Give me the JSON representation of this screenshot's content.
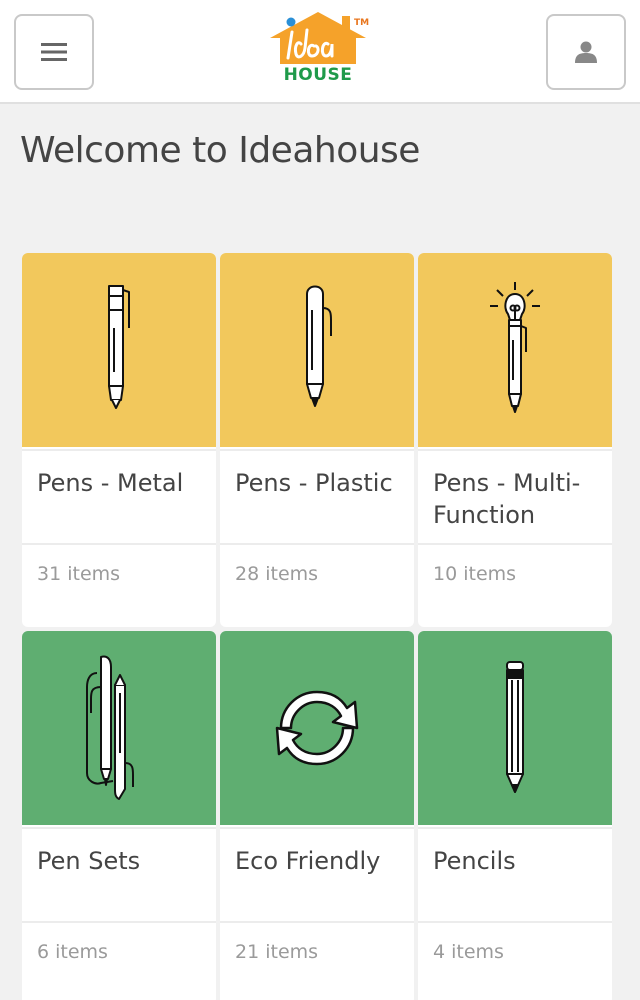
{
  "brand": {
    "logo_word": "HOUSE",
    "logo_tm": "TM"
  },
  "page": {
    "title": "Welcome to Ideahouse"
  },
  "colors": {
    "yellow": "#f2c85c",
    "green": "#5fae71",
    "logo_orange": "#f5a22a",
    "logo_green": "#1f9a4a"
  },
  "categories": [
    {
      "name": "Pens - Metal",
      "count": "31 items",
      "icon": "metal-pen-icon",
      "color": "yellow"
    },
    {
      "name": "Pens - Plastic",
      "count": "28 items",
      "icon": "plastic-pen-icon",
      "color": "yellow"
    },
    {
      "name": "Pens - Multi-Function",
      "count": "10 items",
      "icon": "lightbulb-pen-icon",
      "color": "yellow"
    },
    {
      "name": "Pen Sets",
      "count": "6 items",
      "icon": "pen-set-icon",
      "color": "green"
    },
    {
      "name": "Eco Friendly",
      "count": "21 items",
      "icon": "recycle-icon",
      "color": "green"
    },
    {
      "name": "Pencils",
      "count": "4 items",
      "icon": "pencil-icon",
      "color": "green"
    }
  ]
}
